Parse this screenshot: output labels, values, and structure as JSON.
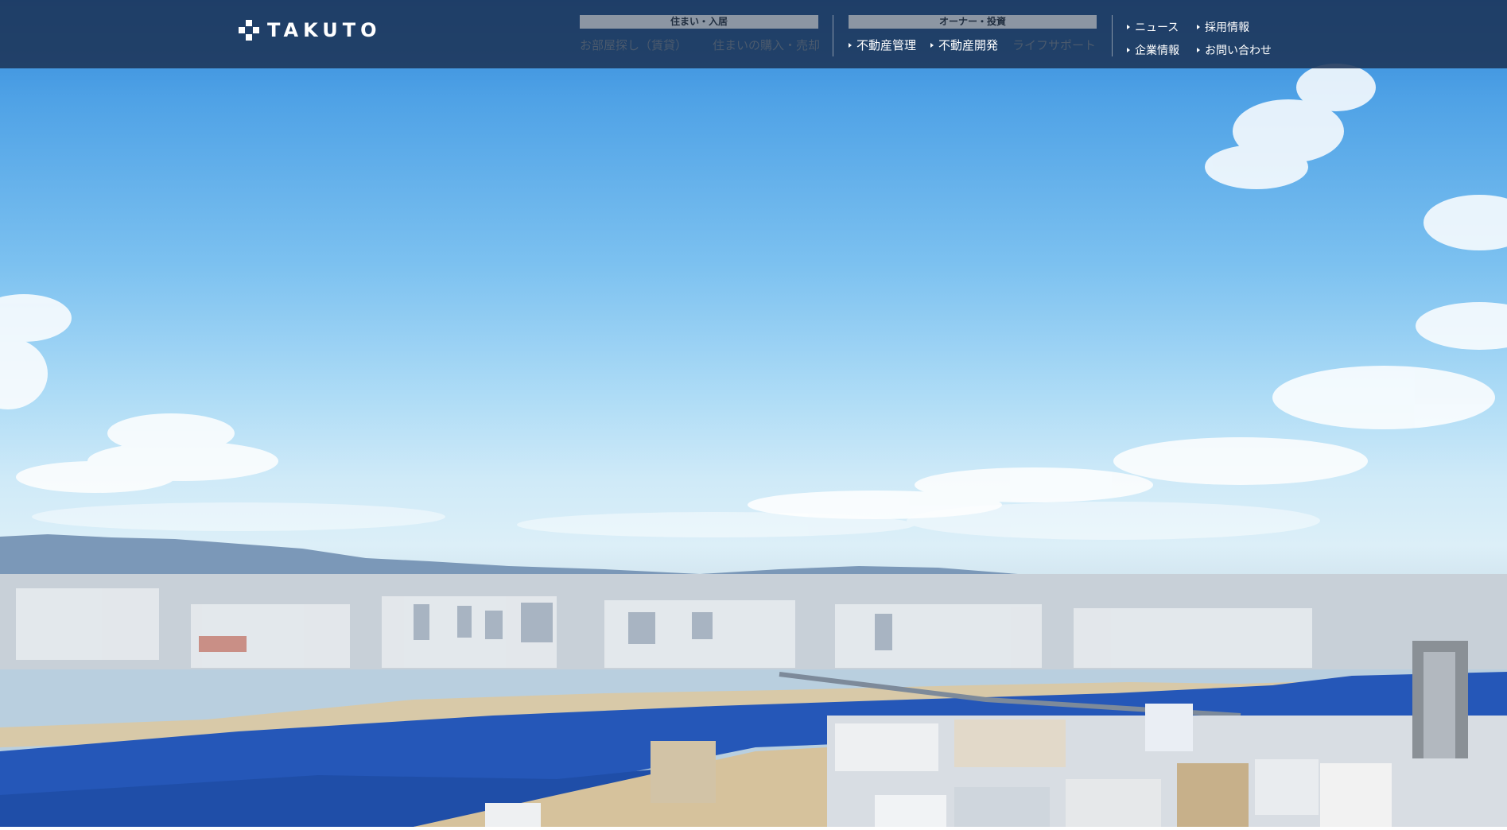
{
  "header": {
    "logo_text": "TAKUTO",
    "group_residence": {
      "label": "住まい・入居",
      "links": [
        {
          "label": "お部屋探し（賃貸）",
          "active": false
        },
        {
          "label": "住まいの購入・売却",
          "active": false
        }
      ]
    },
    "group_owner": {
      "label": "オーナー・投資",
      "links": [
        {
          "label": "不動産管理",
          "active": true
        },
        {
          "label": "不動産開発",
          "active": true
        },
        {
          "label": "ライフサポート",
          "active": false
        }
      ]
    },
    "utility_links": [
      {
        "label": "ニュース"
      },
      {
        "label": "採用情報"
      },
      {
        "label": "企業情報"
      },
      {
        "label": "お問い合わせ"
      }
    ]
  },
  "hero": {
    "image": "osaka-cityscape-river-sky",
    "colors": {
      "sky_top": "#2f86d8",
      "sky_mid": "#aedcf6",
      "river": "#2557b8",
      "header_bg": "#1c3458"
    }
  }
}
